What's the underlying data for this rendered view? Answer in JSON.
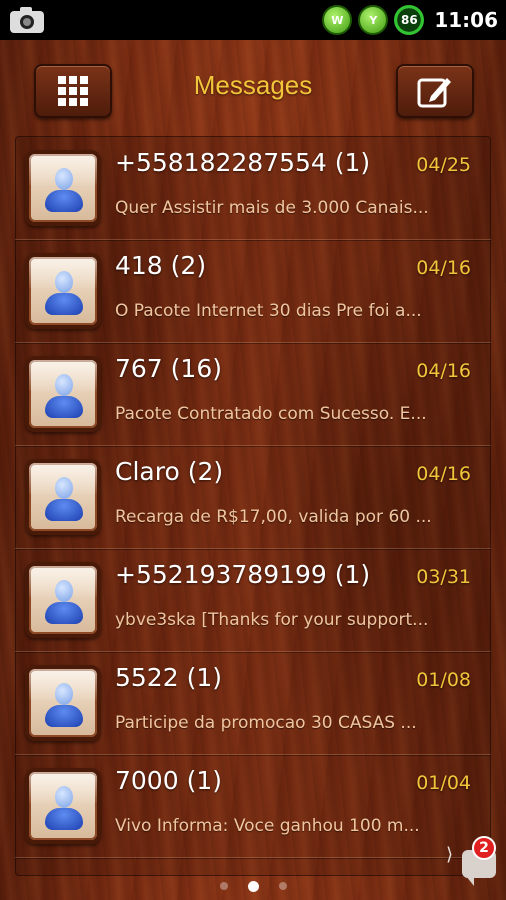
{
  "status_bar": {
    "left_icons": [
      "camera-icon"
    ],
    "right_icons": [
      {
        "name": "w-app-icon",
        "text": "W"
      },
      {
        "name": "signal-icon",
        "text": "Y"
      },
      {
        "name": "battery-icon",
        "text": "86"
      }
    ],
    "time": "11:06"
  },
  "header": {
    "title": "Messages",
    "left_button_icon": "grid-icon",
    "right_button_icon": "compose-icon"
  },
  "colors": {
    "title": "#f2c53a",
    "date": "#f2c53a",
    "preview": "#f0c6a0",
    "name": "#ffffff"
  },
  "threads": [
    {
      "name": "+558182287554 (1)",
      "date": "04/25",
      "preview": "Quer Assistir mais de 3.000 Canais..."
    },
    {
      "name": "418 (2)",
      "date": "04/16",
      "preview": "O Pacote Internet 30 dias Pre foi a..."
    },
    {
      "name": "767 (16)",
      "date": "04/16",
      "preview": "Pacote Contratado com Sucesso. E..."
    },
    {
      "name": "Claro (2)",
      "date": "04/16",
      "preview": "Recarga de R$17,00, valida por 60 ..."
    },
    {
      "name": "+552193789199 (1)",
      "date": "03/31",
      "preview": "ybve3ska [Thanks for your support..."
    },
    {
      "name": "5522 (1)",
      "date": "01/08",
      "preview": "Participe da promocao 30 CASAS ..."
    },
    {
      "name": "7000 (1)",
      "date": "01/04",
      "preview": "Vivo Informa: Voce ganhou 100 m..."
    }
  ],
  "pager": {
    "count": 3,
    "active": 1
  },
  "notification": {
    "badge_count": "2",
    "icon": "message-bubble-icon"
  }
}
